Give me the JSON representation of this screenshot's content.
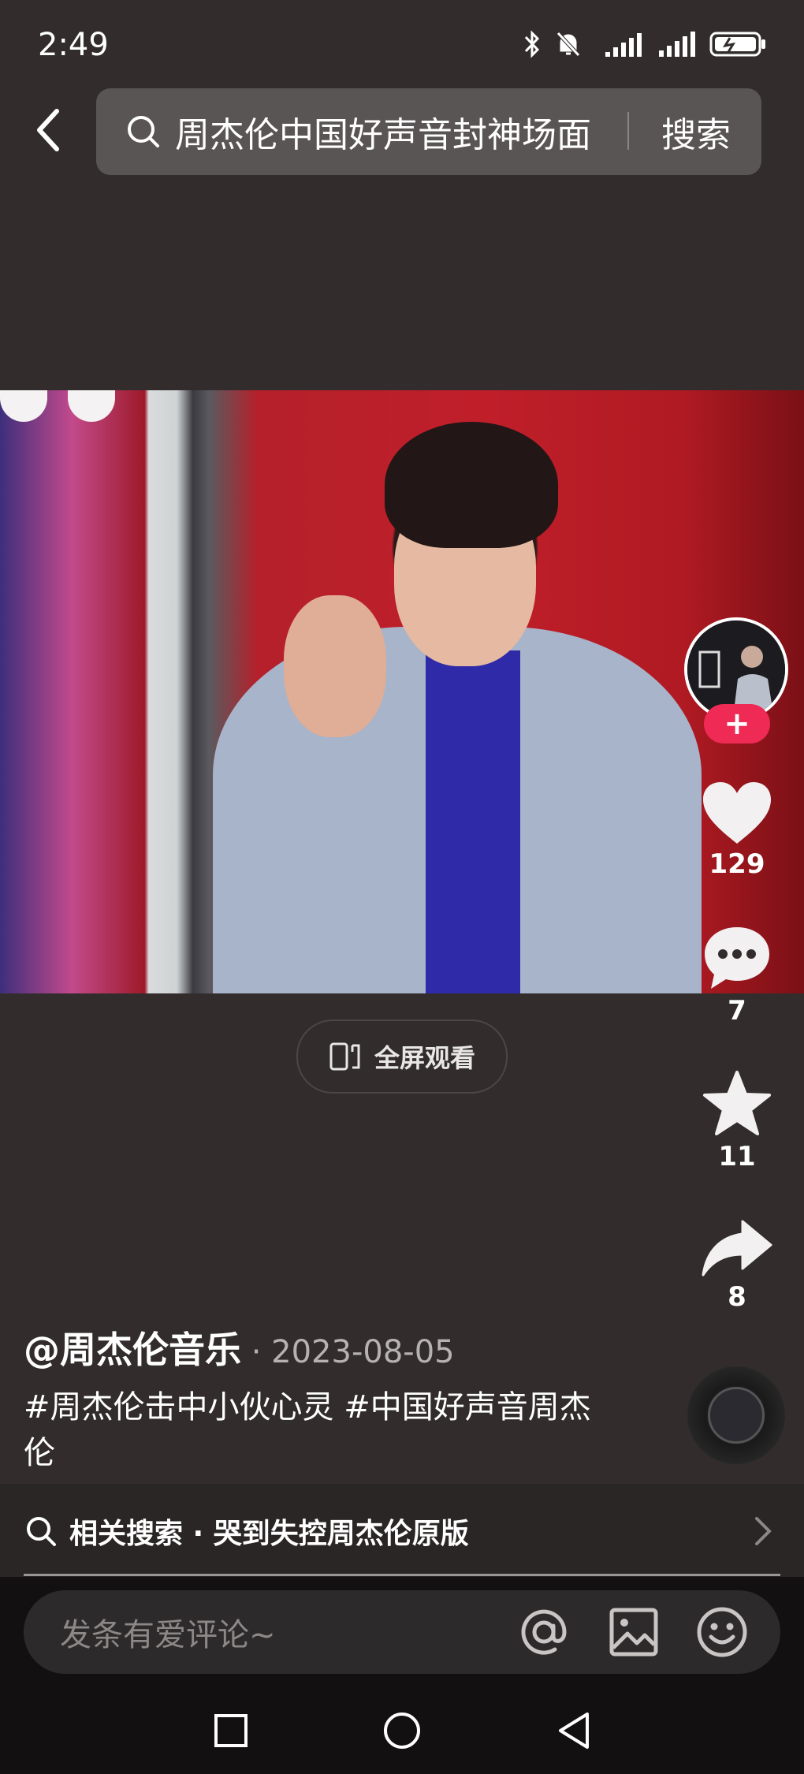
{
  "status_bar": {
    "time": "2:49"
  },
  "header": {
    "search_query": "周杰伦中国好声音封神场面",
    "search_button": "搜索"
  },
  "video": {
    "fullscreen_label": "全屏观看"
  },
  "actions": {
    "like_count": "129",
    "comment_count": "7",
    "favorite_count": "11",
    "share_count": "8",
    "follow_symbol": "+"
  },
  "post": {
    "author": "@周杰伦音乐",
    "separator": " · ",
    "date": "2023-08-05",
    "caption": "#周杰伦击中小伙心灵 #中国好声音周杰伦"
  },
  "related_search": {
    "label": "相关搜索",
    "separator": " · ",
    "query": "哭到失控周杰伦原版"
  },
  "comment_bar": {
    "placeholder": "发条有爱评论~"
  },
  "colors": {
    "background": "#322c2c",
    "follow_button": "#ee2a55",
    "search_box": "#5a5555"
  }
}
